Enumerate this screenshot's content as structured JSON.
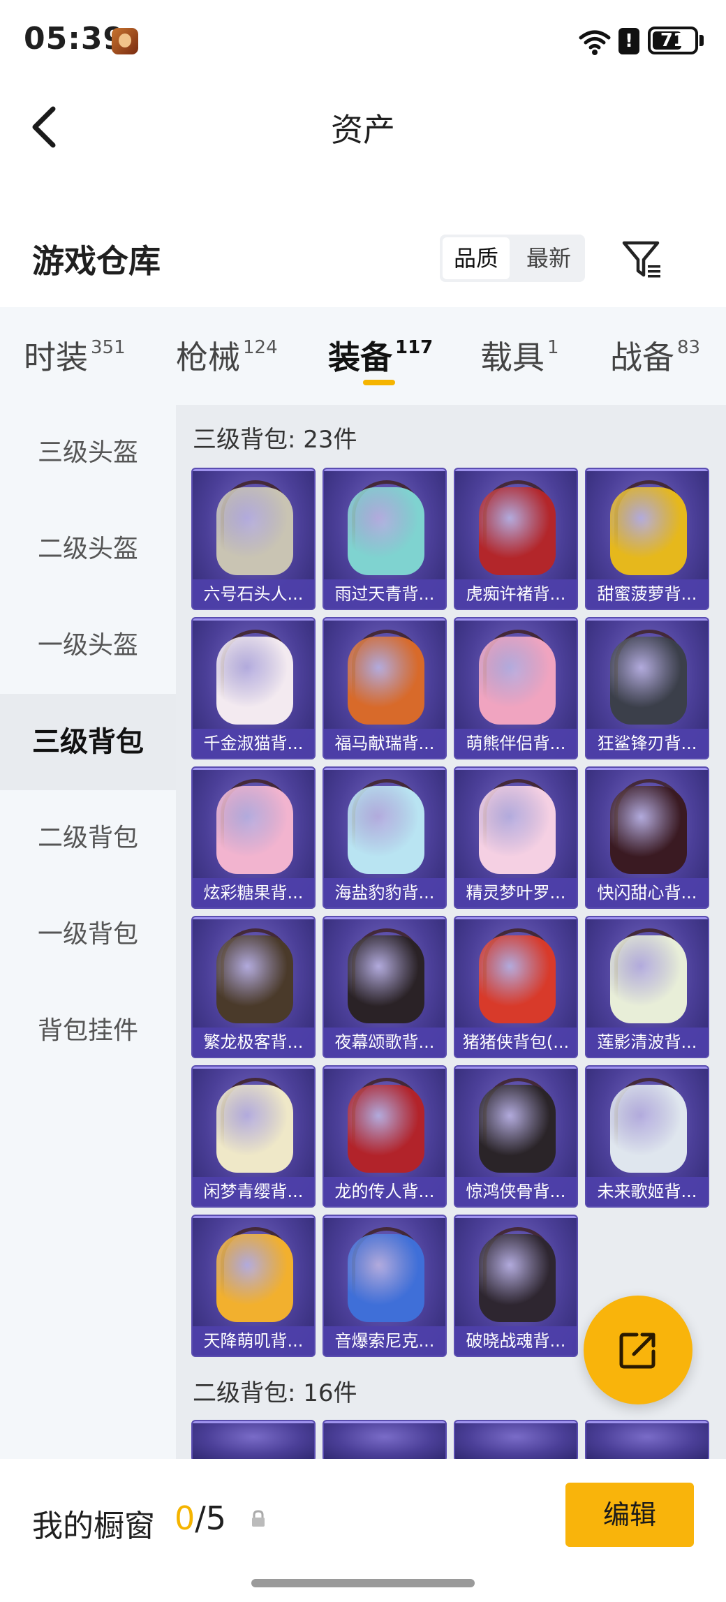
{
  "status_bar": {
    "time": "05:39",
    "battery": "71",
    "battery_fraction": 0.71
  },
  "header": {
    "title": "资产"
  },
  "warehouse": {
    "title": "游戏仓库",
    "sort_quality": "品质",
    "sort_newest": "最新"
  },
  "tabs": [
    {
      "label": "时装",
      "count": "351"
    },
    {
      "label": "枪械",
      "count": "124"
    },
    {
      "label": "装备",
      "count": "117"
    },
    {
      "label": "载具",
      "count": "1"
    },
    {
      "label": "战备",
      "count": "83"
    }
  ],
  "sidebar": {
    "items": [
      {
        "label": "三级头盔"
      },
      {
        "label": "二级头盔"
      },
      {
        "label": "一级头盔"
      },
      {
        "label": "三级背包"
      },
      {
        "label": "二级背包"
      },
      {
        "label": "一级背包"
      },
      {
        "label": "背包挂件"
      }
    ]
  },
  "groups": [
    {
      "title": "三级背包: 23件",
      "items": [
        {
          "name": "六号石头人...",
          "color": "#c9c4b3"
        },
        {
          "name": "雨过天青背...",
          "color": "#7fd3d0"
        },
        {
          "name": "虎痴许褚背...",
          "color": "#b3262a"
        },
        {
          "name": "甜蜜菠萝背...",
          "color": "#e6b81c"
        },
        {
          "name": "千金淑猫背...",
          "color": "#f3eaf0"
        },
        {
          "name": "福马献瑞背...",
          "color": "#d86a2a"
        },
        {
          "name": "萌熊伴侣背...",
          "color": "#f0a4c0"
        },
        {
          "name": "狂鲨锋刃背...",
          "color": "#3b3f4a"
        },
        {
          "name": "炫彩糖果背...",
          "color": "#f2b4cf"
        },
        {
          "name": "海盐豹豹背...",
          "color": "#b9e4f2"
        },
        {
          "name": "精灵梦叶罗...",
          "color": "#f5d0e3"
        },
        {
          "name": "快闪甜心背...",
          "color": "#3a1a22"
        },
        {
          "name": "繁龙极客背...",
          "color": "#4a3a2a"
        },
        {
          "name": "夜幕颂歌背...",
          "color": "#2a2226"
        },
        {
          "name": "猪猪侠背包(...",
          "color": "#d83a2a"
        },
        {
          "name": "莲影清波背...",
          "color": "#e8eed8"
        },
        {
          "name": "闲梦青缨背...",
          "color": "#efe8c8"
        },
        {
          "name": "龙的传人背...",
          "color": "#b2232a"
        },
        {
          "name": "惊鸿侠骨背...",
          "color": "#2a2428"
        },
        {
          "name": "未来歌姬背...",
          "color": "#dfe6ee"
        },
        {
          "name": "天降萌叽背...",
          "color": "#f2b02e"
        },
        {
          "name": "音爆索尼克...",
          "color": "#3f6fd8"
        },
        {
          "name": "破晓战魂背...",
          "color": "#2e2630"
        }
      ]
    },
    {
      "title": "二级背包: 16件",
      "items": [
        {
          "name": "",
          "color": "#4b3f98"
        },
        {
          "name": "",
          "color": "#4b3f98"
        },
        {
          "name": "",
          "color": "#4b3f98"
        },
        {
          "name": "",
          "color": "#4b3f98"
        }
      ]
    }
  ],
  "showcase": {
    "label": "我的橱窗",
    "current": "0",
    "total": "/5",
    "edit_label": "编辑"
  }
}
